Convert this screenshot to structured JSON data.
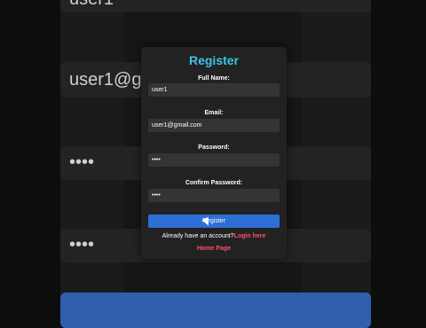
{
  "background": {
    "top_partial_text": "user1",
    "username_text": "user1@g",
    "password_mask_1": "••••",
    "password_mask_2": "••••"
  },
  "form": {
    "title": "Register",
    "fields": [
      {
        "label": "Full Name:",
        "value": "user1"
      },
      {
        "label": "Email:",
        "value": "user1@gmail.com"
      },
      {
        "label": "Password:",
        "value": "••••"
      },
      {
        "label": "Confirm Password:",
        "value": "••••"
      }
    ],
    "submit_label": "Register",
    "account_prompt": "Already have an account?",
    "login_link": "Login here",
    "home_link": "Home Page"
  },
  "colors": {
    "title": "#3fc3e8",
    "button": "#2d6fd6",
    "link": "#ff4f6e"
  }
}
